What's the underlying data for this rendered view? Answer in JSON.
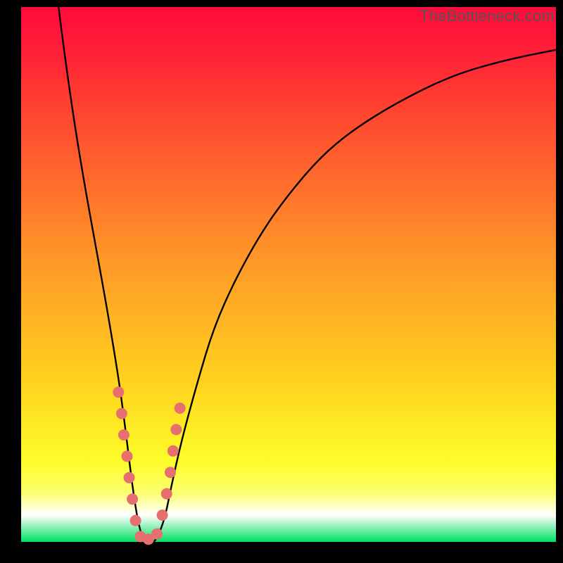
{
  "watermark": {
    "text": "TheBottleneck.com"
  },
  "colors": {
    "frame": "#000000",
    "curve_stroke": "#000000",
    "marker_fill": "#e86f6f",
    "marker_stroke": "#c95a5a",
    "gradient_top": "#ff0a3c",
    "gradient_bottom": "#00e060"
  },
  "chart_data": {
    "type": "line",
    "title": "",
    "xlabel": "",
    "ylabel": "",
    "xlim": [
      0,
      100
    ],
    "ylim": [
      0,
      100
    ],
    "grid": false,
    "series": [
      {
        "name": "curve",
        "x": [
          7,
          8,
          10,
          12,
          14,
          16,
          18,
          19,
          20,
          21,
          22,
          23,
          24,
          25,
          26,
          27,
          28,
          30,
          33,
          36,
          40,
          45,
          50,
          56,
          62,
          70,
          80,
          90,
          100
        ],
        "y": [
          100,
          92,
          78,
          66,
          55,
          44,
          32,
          25,
          17,
          9,
          3,
          0,
          0,
          0,
          2,
          5,
          10,
          19,
          30,
          40,
          49,
          58,
          65,
          72,
          77,
          82,
          87,
          90,
          92
        ]
      }
    ],
    "markers": [
      {
        "x": 18.2,
        "y": 28
      },
      {
        "x": 18.8,
        "y": 24
      },
      {
        "x": 19.2,
        "y": 20
      },
      {
        "x": 19.8,
        "y": 16
      },
      {
        "x": 20.2,
        "y": 12
      },
      {
        "x": 20.8,
        "y": 8
      },
      {
        "x": 21.4,
        "y": 4
      },
      {
        "x": 22.3,
        "y": 1
      },
      {
        "x": 23.8,
        "y": 0.5
      },
      {
        "x": 25.4,
        "y": 1.5
      },
      {
        "x": 26.4,
        "y": 5
      },
      {
        "x": 27.2,
        "y": 9
      },
      {
        "x": 27.9,
        "y": 13
      },
      {
        "x": 28.4,
        "y": 17
      },
      {
        "x": 29.0,
        "y": 21
      },
      {
        "x": 29.7,
        "y": 25
      }
    ],
    "marker_radius_px": 8
  }
}
